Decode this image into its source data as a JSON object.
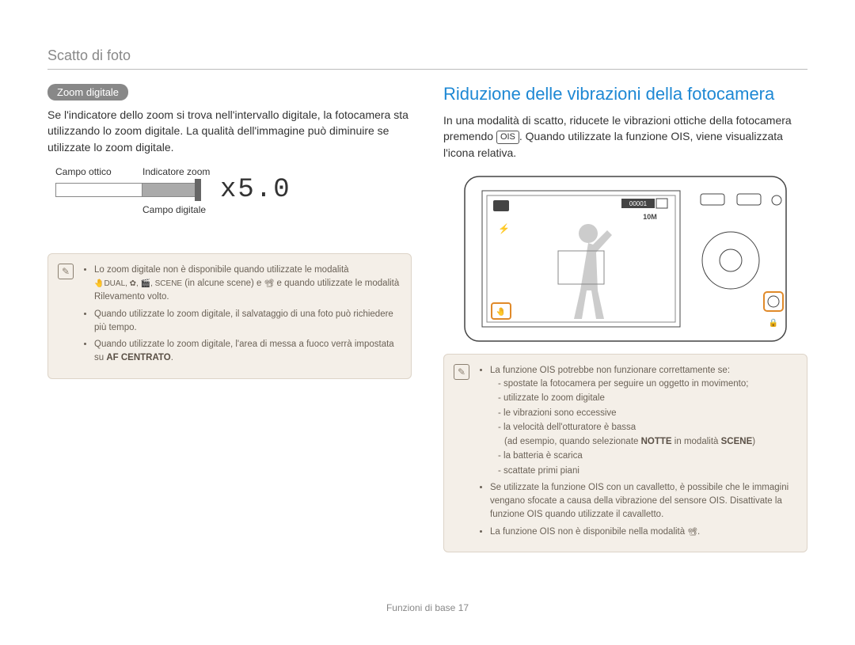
{
  "header": "Scatto di foto",
  "left": {
    "pill": "Zoom digitale",
    "intro": "Se l'indicatore dello zoom si trova nell'intervallo digitale, la fotocamera sta utilizzando lo zoom digitale. La qualità dell'immagine può diminuire se utilizzate lo zoom digitale.",
    "diagram": {
      "optical_label": "Campo ottico",
      "indicator_label": "Indicatore zoom",
      "digital_label": "Campo digitale",
      "zoom_value": "x5.0"
    },
    "note": {
      "bullet1_pre": "Lo zoom digitale non è disponibile quando utilizzate le modalità ",
      "bullet1_modes": "🤚DUAL, ✿, 🎬, SCENE",
      "bullet1_mid": " (in alcune scene) e ",
      "bullet1_video": "📽",
      "bullet1_post": " e quando utilizzate le modalità Rilevamento volto.",
      "bullet2": "Quando utilizzate lo zoom digitale, il salvataggio di una foto può richiedere più tempo.",
      "bullet3_pre": "Quando utilizzate lo zoom digitale, l'area di messa a fuoco verrà impostata su ",
      "bullet3_bold": "AF CENTRATO",
      "bullet3_post": "."
    }
  },
  "right": {
    "title": "Riduzione delle vibrazioni della fotocamera",
    "intro_pre": "In una modalità di scatto, riducete le vibrazioni ottiche della fotocamera premendo ",
    "ois_key": "OIS",
    "intro_post": ". Quando utilizzate la funzione OIS, viene visualizzata l'icona relativa.",
    "screen_labels": {
      "top_right_counter": "00001",
      "res": "10M"
    },
    "note": {
      "bullet1": "La funzione OIS potrebbe non funzionare correttamente se:",
      "dashes": [
        "spostate la fotocamera per seguire un oggetto in movimento;",
        "utilizzate lo zoom digitale",
        "le vibrazioni sono eccessive",
        "la velocità dell'otturatore è bassa"
      ],
      "dash_example_pre": "(ad esempio, quando selezionate ",
      "dash_example_bold1": "NOTTE",
      "dash_example_mid": " in modalità ",
      "dash_example_bold2": "SCENE",
      "dash_example_post": ")",
      "dashes2": [
        "la batteria è scarica",
        "scattate primi piani"
      ],
      "bullet2": "Se utilizzate la funzione OIS con un cavalletto, è possibile che le immagini vengano sfocate a causa della vibrazione del sensore OIS. Disattivate la funzione OIS quando utilizzate il cavalletto.",
      "bullet3_pre": "La funzione OIS non è disponibile nella modalità ",
      "bullet3_glyph": "📽",
      "bullet3_post": "."
    }
  },
  "footer": {
    "label": "Funzioni di base",
    "page": "17"
  }
}
